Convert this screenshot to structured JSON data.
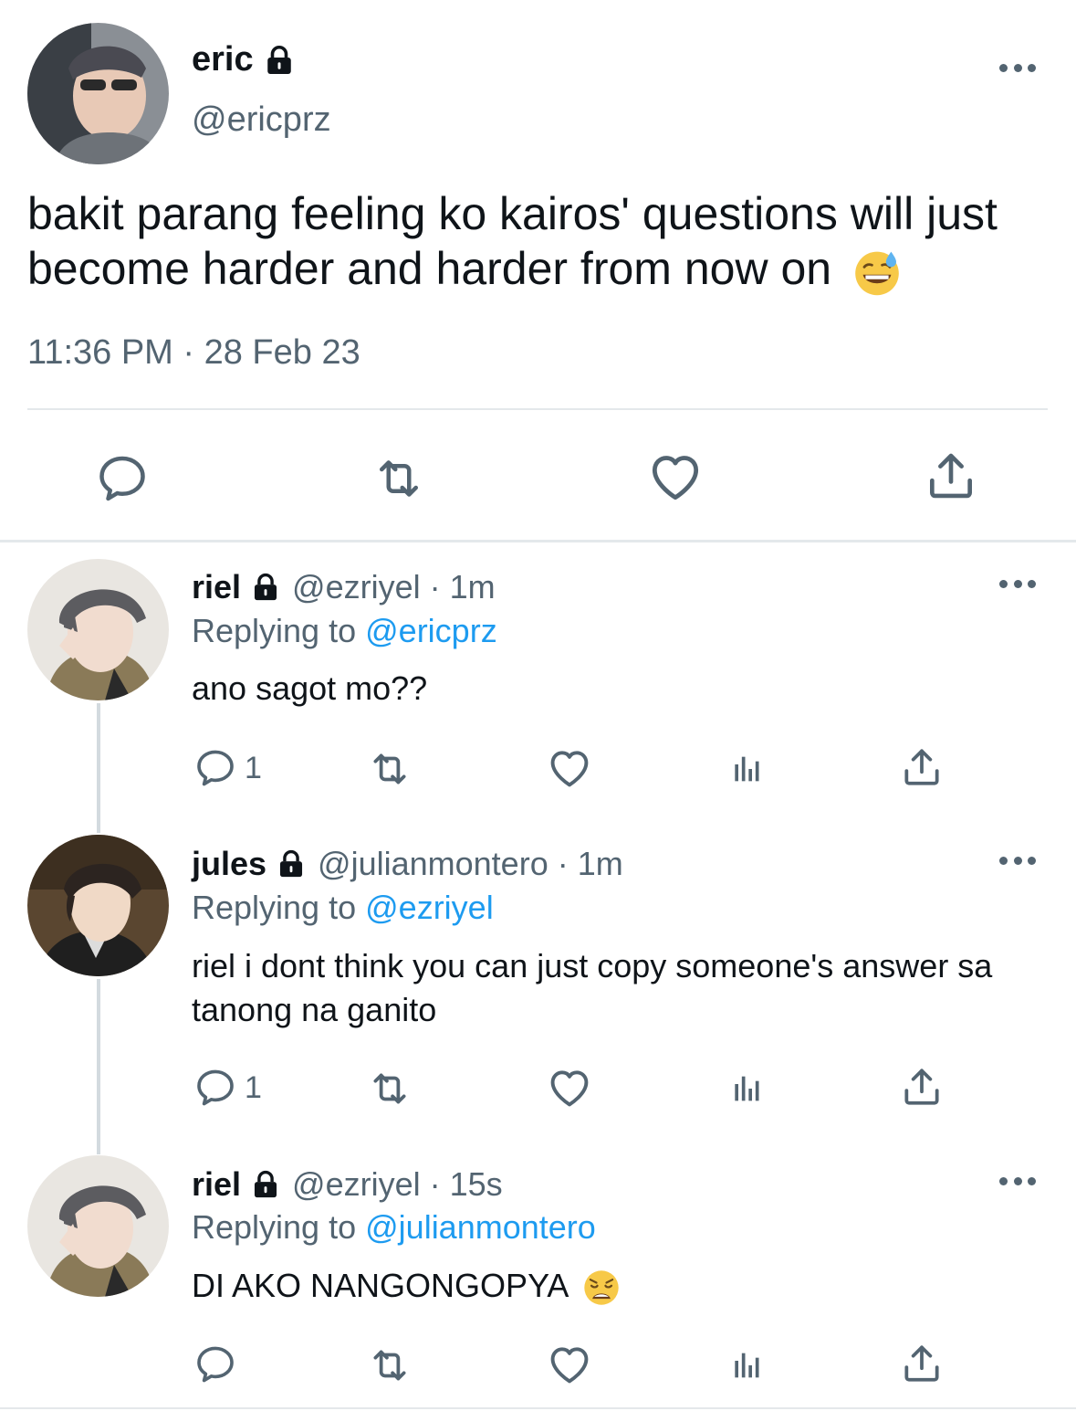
{
  "main_tweet": {
    "name": "eric",
    "handle": "@ericprz",
    "text": "bakit parang feeling ko kairos' questions will just become harder and harder from now on",
    "emoji": "grinning-face-with-sweat",
    "timestamp": "11:36 PM · 28 Feb 23",
    "protected_icon": "lock-icon"
  },
  "replies": [
    {
      "name": "riel",
      "handle": "@ezriyel",
      "time": "1m",
      "replying_prefix": "Replying to",
      "replying_to": "@ericprz",
      "text": "ano sagot mo??",
      "reply_count": "1"
    },
    {
      "name": "jules",
      "handle": "@julianmontero",
      "time": "1m",
      "replying_prefix": "Replying to",
      "replying_to": "@ezriyel",
      "text": "riel i dont think you can just copy someone's answer sa tanong na ganito",
      "reply_count": "1"
    },
    {
      "name": "riel",
      "handle": "@ezriyel",
      "time": "15s",
      "replying_prefix": "Replying to",
      "replying_to": "@julianmontero",
      "text": "DI AKO NANGONGOPYA",
      "emoji": "weary-face",
      "reply_count": ""
    }
  ],
  "separator": "·",
  "icons": {
    "reply": "reply-icon",
    "retweet": "retweet-icon",
    "like": "heart-icon",
    "views": "views-icon",
    "share": "share-icon",
    "more": "more-icon"
  },
  "colors": {
    "text": "#0f1419",
    "muted": "#536471",
    "link": "#1d9bf0",
    "divider": "#e4e8eb"
  }
}
